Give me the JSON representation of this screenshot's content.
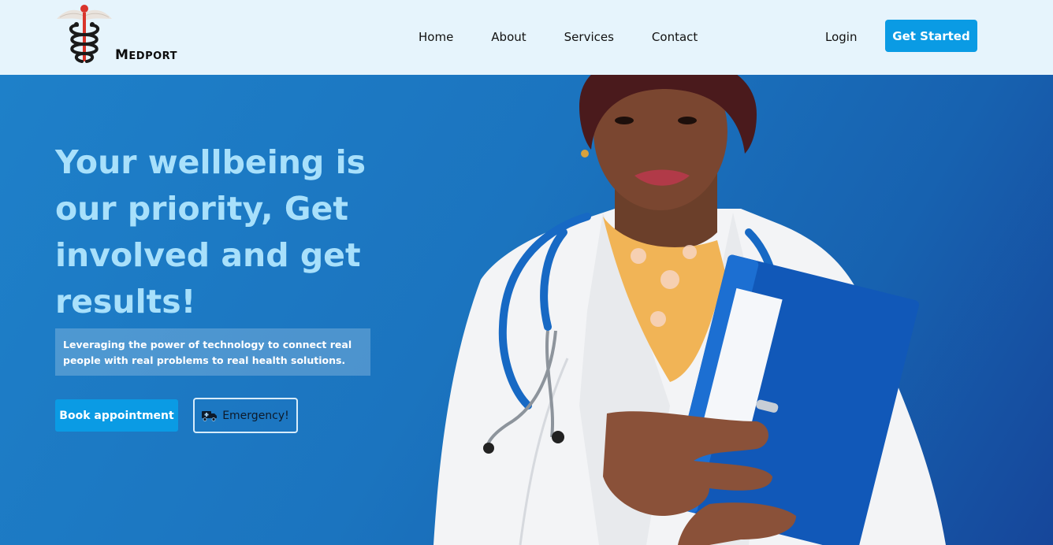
{
  "brand": {
    "logo_icon": "caduceus-icon",
    "name_initial": "M",
    "name_rest": "EDPORT"
  },
  "nav": {
    "items": [
      {
        "label": "Home"
      },
      {
        "label": "About"
      },
      {
        "label": "Services"
      },
      {
        "label": "Contact"
      }
    ],
    "login_label": "Login",
    "cta_label": "Get Started"
  },
  "hero": {
    "title": "Your wellbeing is our priority, Get involved and get results!",
    "description": "Leveraging the power of technology to connect real people with real problems to real health solutions.",
    "book_label": "Book appointment",
    "emergency_label": "Emergency!",
    "emergency_icon": "ambulance-truck-icon",
    "image_subject": "doctor-with-stethoscope-and-blue-binder"
  },
  "colors": {
    "nav_bg": "#e6f4fc",
    "accent": "#0a9be4",
    "hero_bg": "#1b74bf",
    "title_color": "#a8e0fb"
  }
}
